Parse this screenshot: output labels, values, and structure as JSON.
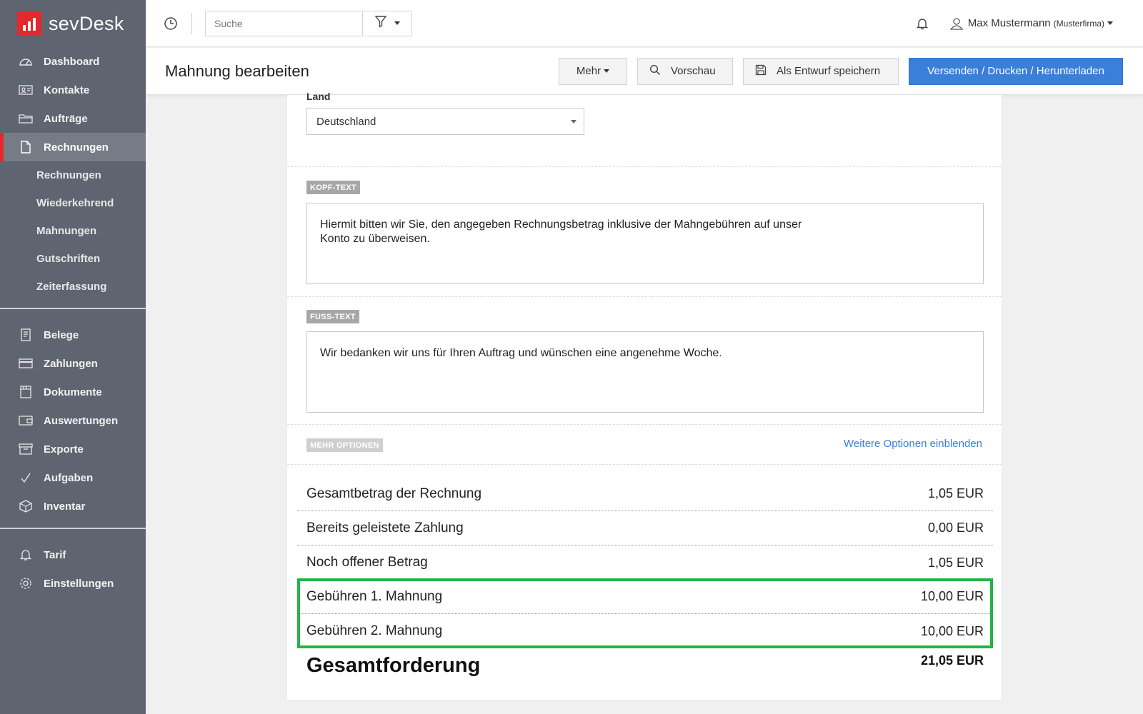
{
  "app": {
    "name": "sevDesk",
    "brand_color": "#e5282b",
    "accent_color": "#3a7fd9",
    "highlight_color": "#22b447"
  },
  "sidebar": {
    "items": [
      {
        "label": "Dashboard",
        "icon": "dashboard-icon"
      },
      {
        "label": "Kontakte",
        "icon": "contacts-icon"
      },
      {
        "label": "Aufträge",
        "icon": "folder-icon"
      },
      {
        "label": "Rechnungen",
        "icon": "document-icon",
        "active": true
      }
    ],
    "subitems": [
      "Rechnungen",
      "Wiederkehrend",
      "Mahnungen",
      "Gutschriften",
      "Zeiterfassung"
    ],
    "items2": [
      {
        "label": "Belege",
        "icon": "receipt-icon"
      },
      {
        "label": "Zahlungen",
        "icon": "credit-card-icon"
      },
      {
        "label": "Dokumente",
        "icon": "documents-icon"
      },
      {
        "label": "Auswertungen",
        "icon": "wallet-icon"
      },
      {
        "label": "Exporte",
        "icon": "archive-icon"
      },
      {
        "label": "Aufgaben",
        "icon": "checkmark-icon"
      },
      {
        "label": "Inventar",
        "icon": "box-icon"
      }
    ],
    "items3": [
      {
        "label": "Tarif",
        "icon": "bell-icon"
      },
      {
        "label": "Einstellungen",
        "icon": "gear-icon"
      }
    ]
  },
  "topbar": {
    "search_placeholder": "Suche",
    "user_name": "Max Mustermann",
    "user_company": "(Musterfirma)"
  },
  "header": {
    "title": "Mahnung bearbeiten",
    "more_label": "Mehr",
    "preview_label": "Vorschau",
    "draft_label": "Als Entwurf speichern",
    "send_label": "Versenden / Drucken / Herunterladen"
  },
  "form": {
    "country_label": "Land",
    "country_value": "Deutschland",
    "head_text_tag": "KOPF-TEXT",
    "head_text": "Hiermit bitten wir Sie, den angegeben Rechnungsbetrag inklusive der Mahngebühren auf unser\nKonto zu überweisen.",
    "foot_text_tag": "FUSS-TEXT",
    "foot_text": "Wir bedanken wir uns für Ihren Auftrag und wünschen eine angenehme Woche.",
    "more_options_tag": "MEHR OPTIONEN",
    "more_options_link": "Weitere Optionen einblenden"
  },
  "summary": {
    "rows": [
      {
        "label": "Gesamtbetrag der Rechnung",
        "value": "1,05 EUR"
      },
      {
        "label": "Bereits geleistete Zahlung",
        "value": "0,00 EUR"
      },
      {
        "label": "Noch offener Betrag",
        "value": "1,05 EUR"
      },
      {
        "label": "Gebühren 1. Mahnung",
        "value": "10,00 EUR"
      },
      {
        "label": "Gebühren 2. Mahnung",
        "value": "10,00 EUR"
      }
    ],
    "total_label": "Gesamtforderung",
    "total_value": "21,05 EUR"
  }
}
